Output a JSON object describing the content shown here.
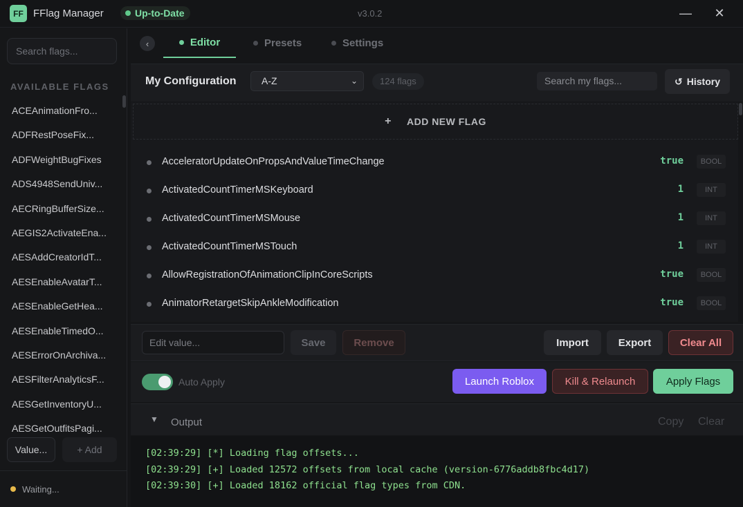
{
  "titlebar": {
    "logo": "FF",
    "app_title": "FFlag Manager",
    "status": "Up-to-Date",
    "version": "v3.0.2",
    "minimize": "—",
    "close": "✕"
  },
  "sidebar": {
    "search_placeholder": "Search flags...",
    "heading": "AVAILABLE FLAGS",
    "items": [
      {
        "label": "ACEAnimationFro..."
      },
      {
        "label": "ADFRestPoseFix..."
      },
      {
        "label": "ADFWeightBugFixes"
      },
      {
        "label": "ADS4948SendUniv..."
      },
      {
        "label": "AECRingBufferSize..."
      },
      {
        "label": "AEGIS2ActivateEna..."
      },
      {
        "label": "AESAddCreatorIdT..."
      },
      {
        "label": "AESEnableAvatarT..."
      },
      {
        "label": "AESEnableGetHea..."
      },
      {
        "label": "AESEnableTimedO..."
      },
      {
        "label": "AESErrorOnArchiva..."
      },
      {
        "label": "AESFilterAnalyticsF..."
      },
      {
        "label": "AESGetInventoryU..."
      },
      {
        "label": "AESGetOutfitsPagi..."
      }
    ],
    "value_button": "Value...",
    "add_button": "+ Add",
    "footer_status": "Waiting..."
  },
  "tabs": [
    {
      "label": "Editor",
      "active": true
    },
    {
      "label": "Presets",
      "active": false
    },
    {
      "label": "Settings",
      "active": false
    }
  ],
  "back_icon": "‹",
  "toolbar": {
    "title": "My Configuration",
    "sort_value": "A-Z",
    "sort_chevron": "⌄",
    "count": "124 flags",
    "search_placeholder": "Search my flags...",
    "history_icon": "↺",
    "history_label": "History"
  },
  "flags_panel": {
    "add_plus": "+",
    "add_label": "ADD NEW FLAG",
    "flags": [
      {
        "name": "AcceleratorUpdateOnPropsAndValueTimeChange",
        "value": "true",
        "type": "BOOL"
      },
      {
        "name": "ActivatedCountTimerMSKeyboard",
        "value": "1",
        "type": "INT"
      },
      {
        "name": "ActivatedCountTimerMSMouse",
        "value": "1",
        "type": "INT"
      },
      {
        "name": "ActivatedCountTimerMSTouch",
        "value": "1",
        "type": "INT"
      },
      {
        "name": "AllowRegistrationOfAnimationClipInCoreScripts",
        "value": "true",
        "type": "BOOL"
      },
      {
        "name": "AnimatorRetargetSkipAnkleModification",
        "value": "true",
        "type": "BOOL"
      }
    ]
  },
  "editbar": {
    "input_placeholder": "Edit value...",
    "save": "Save",
    "remove": "Remove",
    "import": "Import",
    "export": "Export",
    "clear_all": "Clear All"
  },
  "actionbar": {
    "auto_apply_label": "Auto Apply",
    "auto_apply_on": true,
    "launch": "Launch Roblox",
    "kill_relaunch": "Kill & Relaunch",
    "apply": "Apply Flags"
  },
  "output": {
    "toggle_icon": "▼",
    "title": "Output",
    "copy": "Copy",
    "clear": "Clear",
    "lines": [
      "[02:39:29] [*] Loading flag offsets...",
      "[02:39:29] [+] Loaded 12572 offsets from local cache (version-6776addb8fbc4d17)",
      "[02:39:30] [+] Loaded 18162 official flag types from CDN."
    ]
  },
  "colors": {
    "accent_green": "#6fcf9b",
    "launch_purple": "#7b5cf0",
    "danger_red": "#ef8a8e",
    "background": "#151618"
  }
}
